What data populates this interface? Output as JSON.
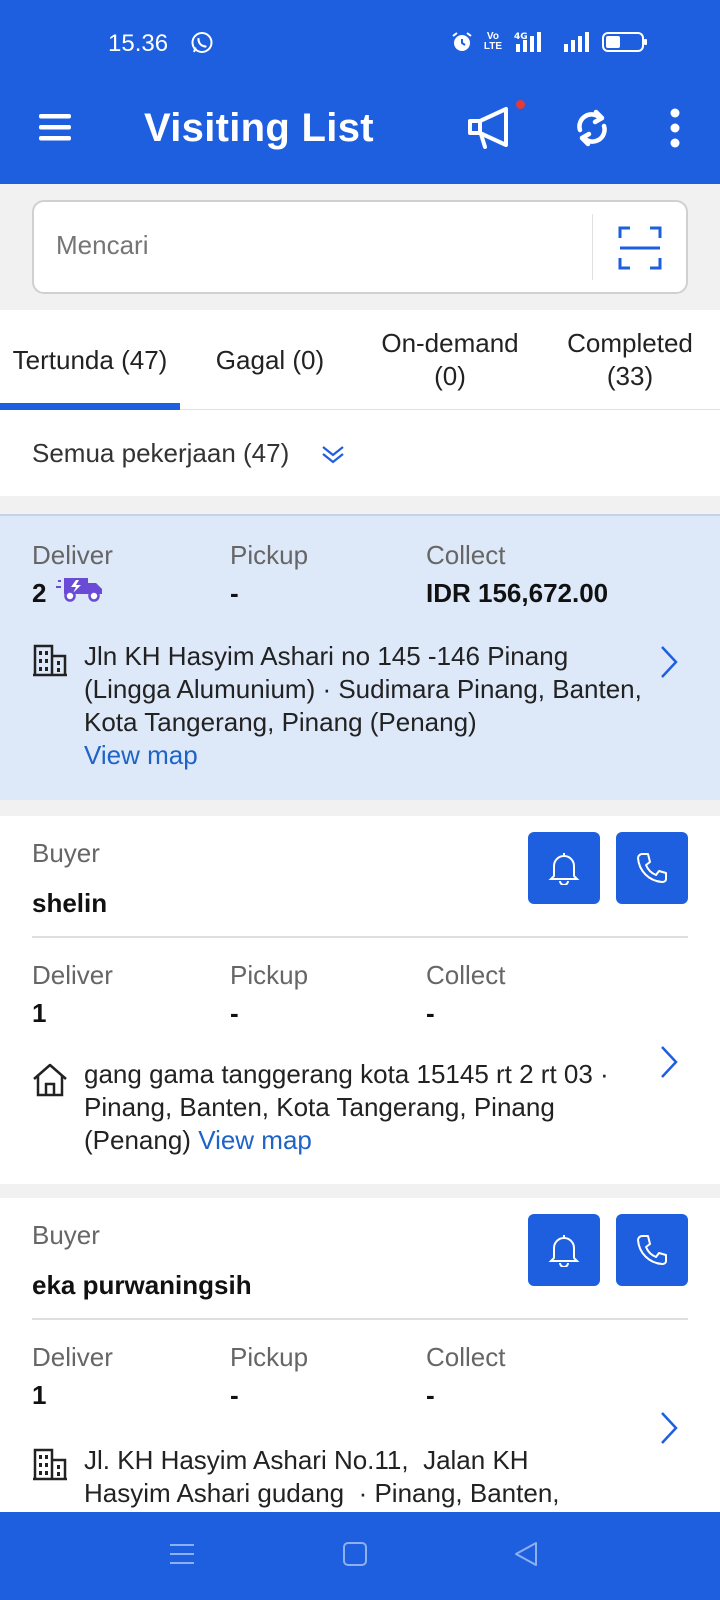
{
  "status_bar": {
    "time": "15.36",
    "volte_label": "Vo\nLTE",
    "network_label": "4G"
  },
  "app_bar": {
    "title": "Visiting List"
  },
  "search": {
    "placeholder": "Mencari"
  },
  "tabs": [
    {
      "label": "Tertunda (47)",
      "active": true
    },
    {
      "label": "Gagal (0)",
      "active": false
    },
    {
      "label_line1": "On-demand",
      "label_line2": "(0)",
      "active": false
    },
    {
      "label_line1": "Completed",
      "label_line2": "(33)",
      "active": false
    }
  ],
  "filter": {
    "label": "Semua pekerjaan (47)"
  },
  "summary_labels": {
    "deliver": "Deliver",
    "pickup": "Pickup",
    "collect": "Collect",
    "buyer": "Buyer",
    "view_map": "View map"
  },
  "cards": [
    {
      "deliver": "2",
      "pickup": "-",
      "collect": "IDR 156,672.00",
      "address": "Jln KH Hasyim Ashari no 145 -146 Pinang (Lingga Alumunium) · Sudimara Pinang, Banten, Kota Tangerang, Pinang (Penang)",
      "address_icon": "building-icon",
      "highlighted": true
    },
    {
      "buyer": "shelin",
      "deliver": "1",
      "pickup": "-",
      "collect": "-",
      "address": "gang gama tanggerang kota 15145 rt 2 rt 03 · Pinang, Banten, Kota Tangerang, Pinang (Penang)",
      "address_icon": "home-icon"
    },
    {
      "buyer": "eka purwaningsih",
      "deliver": "1",
      "pickup": "-",
      "collect": "-",
      "address_line1": "Jl. KH Hasyim Ashari No.11,  Jalan KH",
      "address_line2": "Hasyim Ashari gudang  · Pinang, Banten,",
      "address_icon": "building-icon"
    }
  ],
  "colors": {
    "primary": "#1e5fe0",
    "highlight_bg": "#dde8f9",
    "link": "#1e63c6",
    "truck_accent": "#6a4bd6",
    "notification_dot": "#e53935"
  }
}
